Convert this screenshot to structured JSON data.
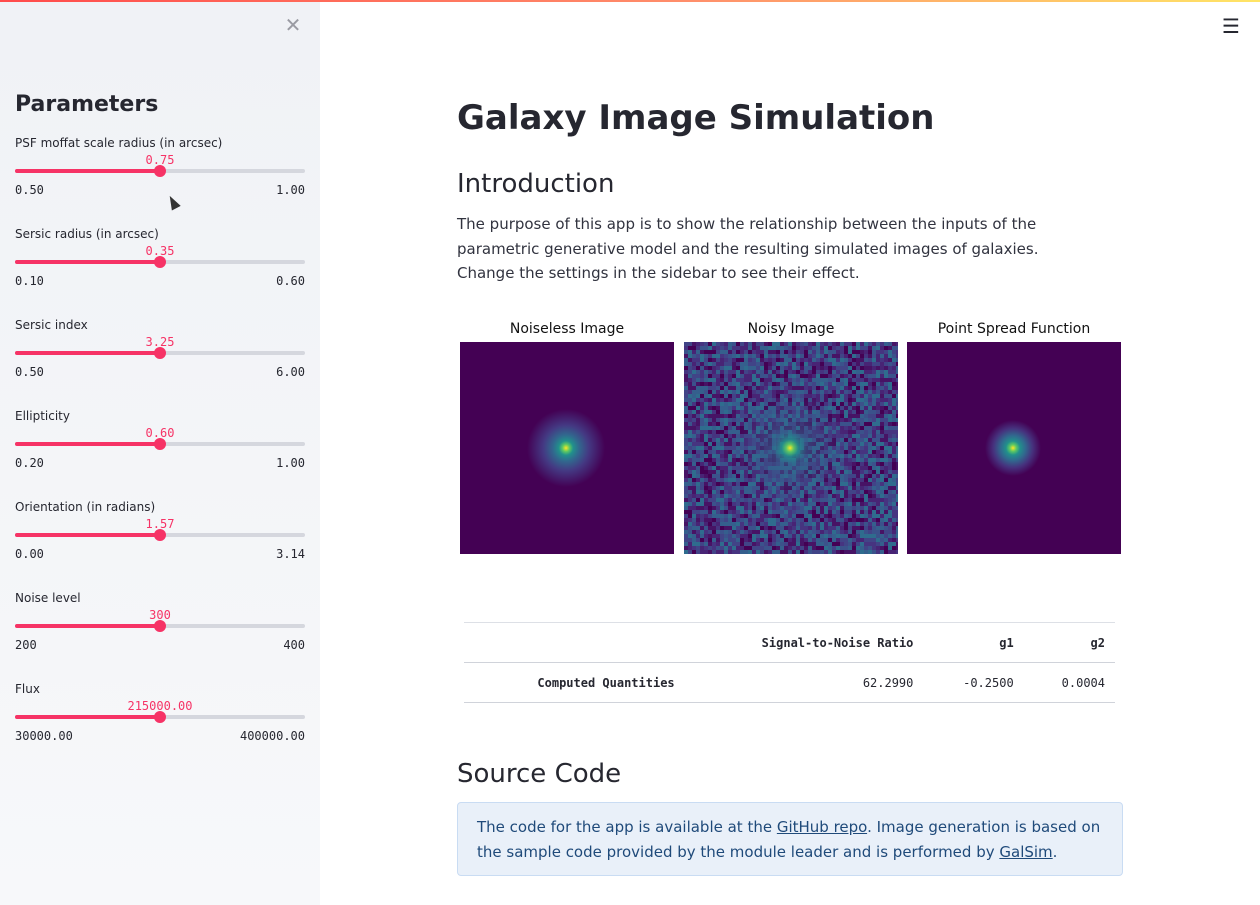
{
  "sidebar": {
    "close_icon": "close-icon",
    "title": "Parameters",
    "sliders": [
      {
        "label": "PSF moffat scale radius (in arcsec)",
        "value": "0.75",
        "min": "0.50",
        "max": "1.00",
        "fraction": 0.5
      },
      {
        "label": "Sersic radius (in arcsec)",
        "value": "0.35",
        "min": "0.10",
        "max": "0.60",
        "fraction": 0.5
      },
      {
        "label": "Sersic index",
        "value": "3.25",
        "min": "0.50",
        "max": "6.00",
        "fraction": 0.5
      },
      {
        "label": "Ellipticity",
        "value": "0.60",
        "min": "0.20",
        "max": "1.00",
        "fraction": 0.5
      },
      {
        "label": "Orientation (in radians)",
        "value": "1.57",
        "min": "0.00",
        "max": "3.14",
        "fraction": 0.5
      },
      {
        "label": "Noise level",
        "value": "300",
        "min": "200",
        "max": "400",
        "fraction": 0.5
      },
      {
        "label": "Flux",
        "value": "215000.00",
        "min": "30000.00",
        "max": "400000.00",
        "fraction": 0.5
      }
    ]
  },
  "header": {
    "menu_icon": "hamburger-menu-icon",
    "menu_glyph": "☰"
  },
  "main": {
    "title": "Galaxy Image Simulation",
    "intro_heading": "Introduction",
    "intro_text": "The purpose of this app is to show the relationship between the inputs of the parametric generative model and the resulting simulated images of galaxies. Change the settings in the sidebar to see their effect.",
    "images": [
      {
        "title": "Noiseless Image"
      },
      {
        "title": "Noisy Image"
      },
      {
        "title": "Point Spread Function"
      }
    ],
    "table": {
      "columns": [
        "",
        "Signal-to-Noise Ratio",
        "g1",
        "g2"
      ],
      "rows": [
        {
          "label": "Computed Quantities",
          "values": [
            "62.2990",
            "-0.2500",
            "0.0004"
          ]
        }
      ]
    },
    "source_heading": "Source Code",
    "source_text_1": "The code for the app is available at the ",
    "source_link_1": "GitHub repo",
    "source_text_2": ". Image generation is based on the sample code provided by the module leader and is performed by ",
    "source_link_2": "GalSim",
    "source_text_3": "."
  },
  "colors": {
    "accent": "#f63366",
    "viridis_dark": "#440154",
    "viridis_mid": "#21918c",
    "viridis_bright": "#fde725"
  }
}
